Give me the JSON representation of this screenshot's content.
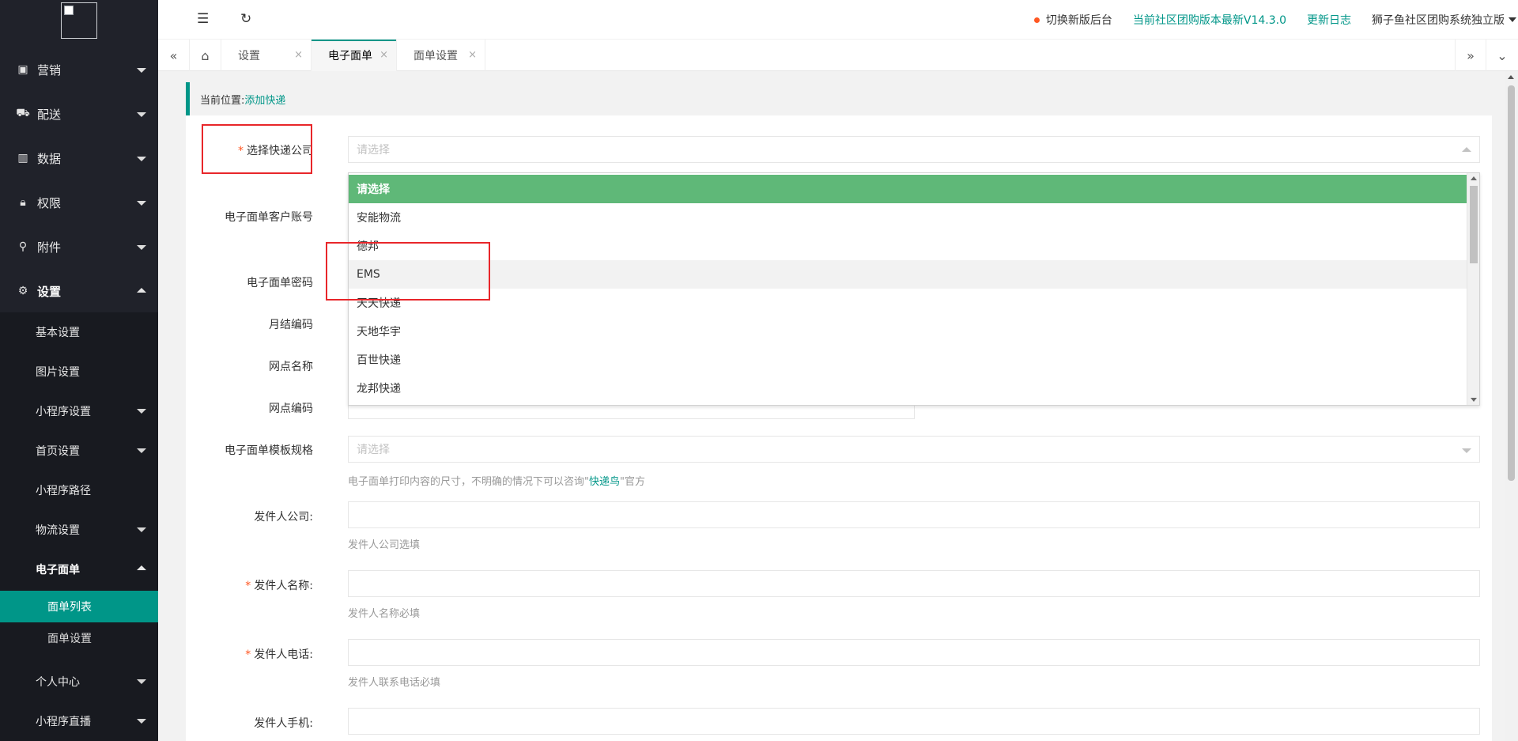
{
  "sidebar": {
    "menus": [
      {
        "label": "营销",
        "icon": "gift-icon"
      },
      {
        "label": "配送",
        "icon": "truck-icon"
      },
      {
        "label": "数据",
        "icon": "bar-chart-icon"
      },
      {
        "label": "权限",
        "icon": "lock-icon"
      },
      {
        "label": "附件",
        "icon": "paperclip-icon"
      },
      {
        "label": "设置",
        "icon": "gear-icon"
      }
    ],
    "submenus": [
      {
        "label": "基本设置"
      },
      {
        "label": "图片设置"
      },
      {
        "label": "小程序设置"
      },
      {
        "label": "首页设置"
      },
      {
        "label": "小程序路径"
      },
      {
        "label": "物流设置"
      },
      {
        "label": "电子面单"
      },
      {
        "label": "个人中心"
      },
      {
        "label": "小程序直播"
      }
    ],
    "subsub": [
      {
        "label": "面单列表"
      },
      {
        "label": "面单设置"
      }
    ]
  },
  "topbar": {
    "switch_label": "切换新版后台",
    "version_label": "当前社区团购版本最新V14.3.0",
    "changelog_label": "更新日志",
    "brand_label": "狮子鱼社区团购系统独立版"
  },
  "tabs": [
    {
      "label": "设置"
    },
    {
      "label": "电子面单"
    },
    {
      "label": "面单设置"
    }
  ],
  "breadcrumb": {
    "prefix": "当前位置:",
    "current": "添加快递"
  },
  "form": {
    "company_label": "选择快递公司",
    "company_placeholder": "请选择",
    "account_label": "电子面单客户账号",
    "password_label": "电子面单密码",
    "monthly_label": "月结编码",
    "site_name_label": "网点名称",
    "site_code_label": "网点编码",
    "template_label": "电子面单模板规格",
    "template_placeholder": "请选择",
    "template_hint_pre": "电子面单打印内容的尺寸，不明确的情况下可以咨询\"",
    "template_hint_link": "快递鸟",
    "template_hint_post": "\"官方",
    "sender_company_label": "发件人公司:",
    "sender_company_hint": "发件人公司选填",
    "sender_name_label": "发件人名称:",
    "sender_name_hint": "发件人名称必填",
    "sender_phone_label": "发件人电话:",
    "sender_phone_hint": "发件人联系电话必填",
    "sender_mobile_label": "发件人手机:"
  },
  "dropdown": {
    "options": [
      "请选择",
      "安能物流",
      "德邦",
      "EMS",
      "天天快递",
      "天地华宇",
      "百世快递",
      "龙邦快递"
    ],
    "selected": "请选择",
    "hovered": "EMS"
  },
  "colors": {
    "accent": "#009688",
    "selected_option": "#5fb878",
    "annotation": "#e8262a"
  }
}
